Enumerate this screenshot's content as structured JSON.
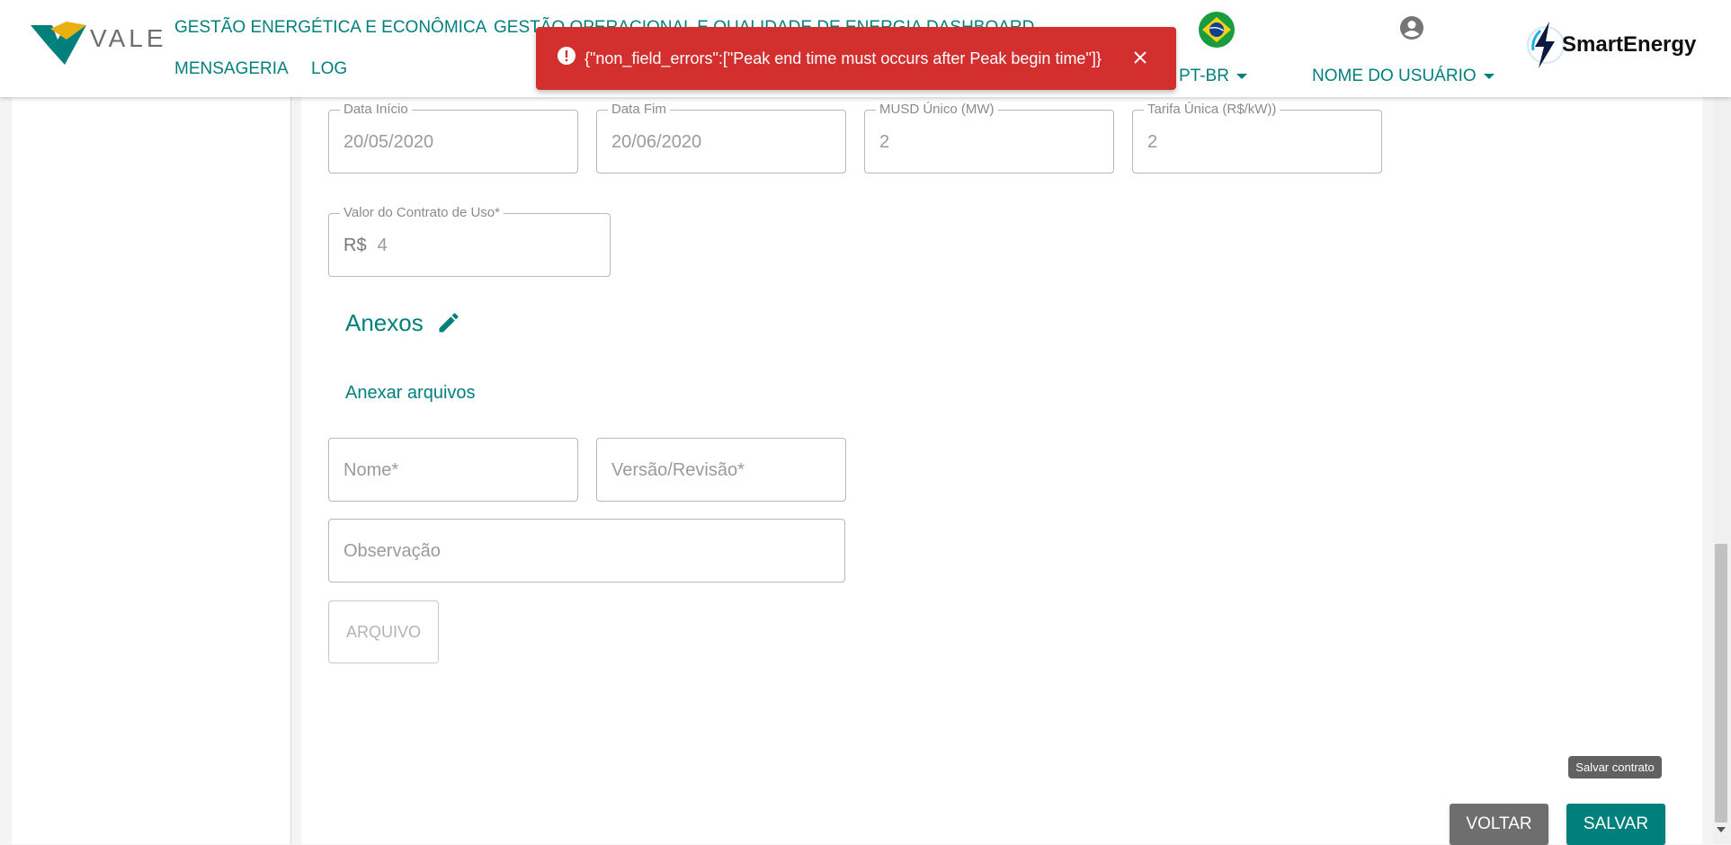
{
  "header": {
    "logo_text": "VALE",
    "nav": [
      {
        "label": "GESTÃO ENERGÉTICA E ECONÔMICA"
      },
      {
        "label": "GESTÃO OPERACIONAL E QUALIDADE DE ENERGIA"
      },
      {
        "label": "DASHBOARD"
      },
      {
        "label": "MENSAGERIA"
      },
      {
        "label": "LOG"
      }
    ],
    "language": "PT-BR",
    "user_name": "NOME DO USUÁRIO",
    "brand_text": "SmartEnergy"
  },
  "toast": {
    "message": "{\"non_field_errors\":[\"Peak end time must occurs after Peak begin time\"]}"
  },
  "form": {
    "data_inicio": {
      "label": "Data Início",
      "value": "20/05/2020"
    },
    "data_fim": {
      "label": "Data Fim",
      "value": "20/06/2020"
    },
    "musd_unico": {
      "label": "MUSD Único (MW)",
      "value": "2"
    },
    "tarifa_unica": {
      "label": "Tarifa Única (R$/kW))",
      "value": "2"
    },
    "valor_contrato": {
      "label": "Valor do Contrato de Uso*",
      "prefix": "R$",
      "value": "4"
    }
  },
  "anexos": {
    "title": "Anexos",
    "attach_link": "Anexar arquivos",
    "nome_placeholder": "Nome*",
    "versao_placeholder": "Versão/Revisão*",
    "observacao_placeholder": "Observação",
    "file_button": "ARQUIVO"
  },
  "actions": {
    "tooltip": "Salvar contrato",
    "back": "VOLTAR",
    "save": "SALVAR"
  },
  "colors": {
    "primary": "#00807c",
    "error": "#d32f2f",
    "back_button": "#6e6e6e"
  }
}
